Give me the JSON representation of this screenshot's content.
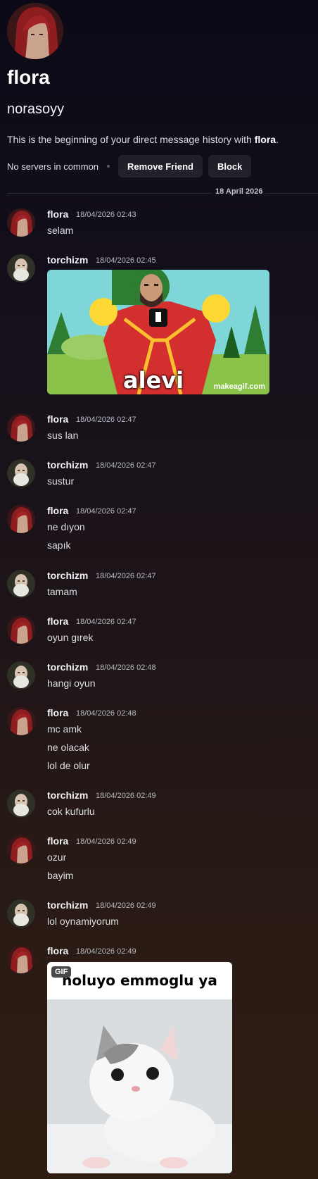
{
  "profile": {
    "display_name": "flora",
    "username": "norasoyy",
    "intro_prefix": "This is the beginning of your direct message history with ",
    "intro_name": "flora",
    "intro_suffix": ".",
    "mutual_servers": "No servers in common",
    "remove_friend_label": "Remove Friend",
    "block_label": "Block"
  },
  "date_divider": "18 April 2026",
  "messages": [
    {
      "author": "flora",
      "time": "18/04/2026 02:43",
      "lines": [
        "selam"
      ]
    },
    {
      "author": "torchizm",
      "time": "18/04/2026 02:45",
      "lines": [],
      "embed": "alevi"
    },
    {
      "author": "flora",
      "time": "18/04/2026 02:47",
      "lines": [
        "sus lan"
      ]
    },
    {
      "author": "torchizm",
      "time": "18/04/2026 02:47",
      "lines": [
        "sustur"
      ]
    },
    {
      "author": "flora",
      "time": "18/04/2026 02:47",
      "lines": [
        "ne dıyon",
        "sapık"
      ]
    },
    {
      "author": "torchizm",
      "time": "18/04/2026 02:47",
      "lines": [
        "tamam"
      ]
    },
    {
      "author": "flora",
      "time": "18/04/2026 02:47",
      "lines": [
        "oyun gırek"
      ]
    },
    {
      "author": "torchizm",
      "time": "18/04/2026 02:48",
      "lines": [
        "hangi oyun"
      ]
    },
    {
      "author": "flora",
      "time": "18/04/2026 02:48",
      "lines": [
        "mc amk",
        "ne olacak",
        "lol de olur"
      ]
    },
    {
      "author": "torchizm",
      "time": "18/04/2026 02:49",
      "lines": [
        "cok kufurlu"
      ]
    },
    {
      "author": "flora",
      "time": "18/04/2026 02:49",
      "lines": [
        "ozur",
        "bayim"
      ]
    },
    {
      "author": "torchizm",
      "time": "18/04/2026 02:49",
      "lines": [
        "lol oynamiyorum"
      ]
    },
    {
      "author": "flora",
      "time": "18/04/2026 02:49",
      "lines": [],
      "gif": true
    }
  ],
  "embed1": {
    "overlay_text": "alevi",
    "watermark": "makeagif.com"
  },
  "embed2": {
    "badge": "GIF",
    "caption": "noluyo emmoglu ya"
  },
  "colors": {
    "accent_background": "#1a1219",
    "flora_avatar": "#7a1a1f",
    "torchizm_avatar": "#3a3a2e"
  }
}
